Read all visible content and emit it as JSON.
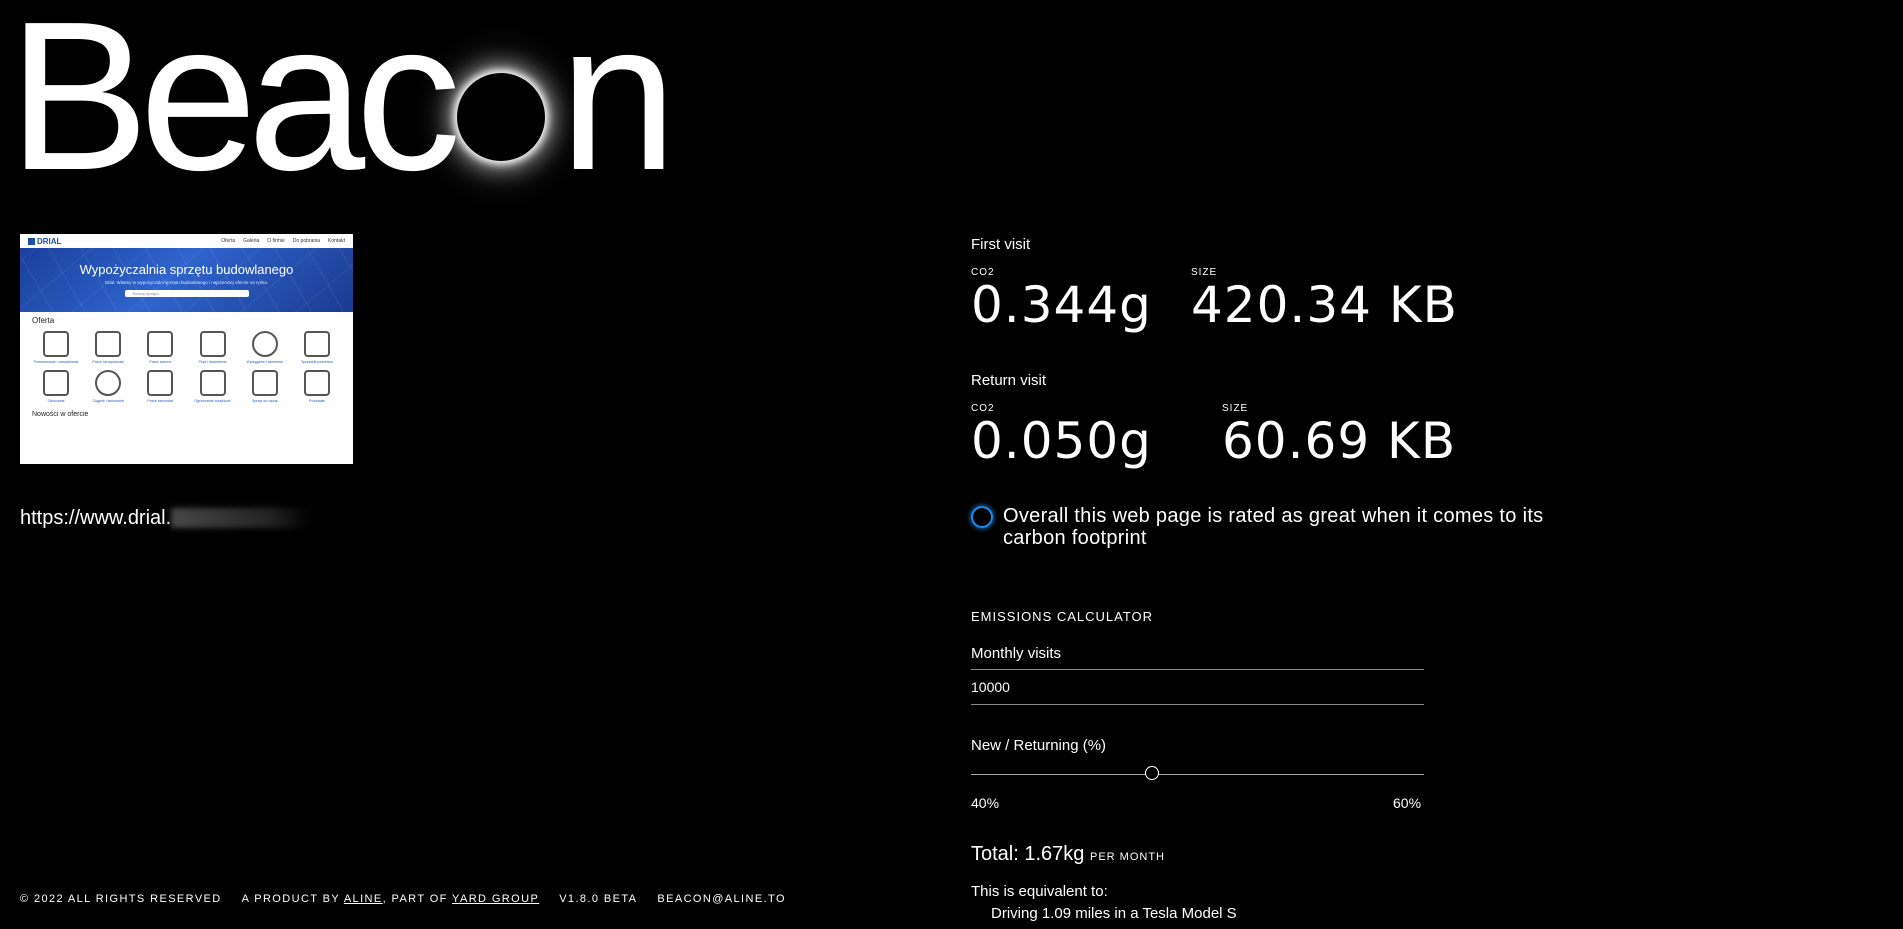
{
  "logo": {
    "before": "Beac",
    "after": "n"
  },
  "thumbnail": {
    "brand": "DRIAL",
    "nav": [
      "Oferta",
      "Galeria",
      "O firmie",
      "Do pobrania",
      "Kontakt"
    ],
    "hero_title": "Wypożyczalnia sprzętu budowlanego",
    "hero_subtitle": "Drial. Witamy w wypożyczalni sprzętu budowlanego i najszerszej ofercie na rynku.",
    "search_placeholder": "Szukaj sprzętu",
    "section": "Oferta",
    "items": [
      "Pomurowanie i odwadnianie",
      "Prace na wysokości",
      "Prace ziemne",
      "Prąd i oświetlenie",
      "Wyciąganie i wiercenie",
      "Sprężarki powietrza",
      "Osuszanie",
      "Ciągnie i ładowanie",
      "Prace betonowe",
      "Ogrzewanie budynków",
      "Sprzęt do cięcia",
      "Pozostałe"
    ],
    "footer_section": "Nowości w ofercie"
  },
  "url": "https://www.drial.",
  "first_visit": {
    "title": "First visit",
    "co2_label": "CO2",
    "co2": "0.344g",
    "size_label": "SIZE",
    "size": "420.34 KB"
  },
  "return_visit": {
    "title": "Return visit",
    "co2_label": "CO2",
    "co2": "0.050g",
    "size_label": "SIZE",
    "size": "60.69 KB"
  },
  "rating": "Overall this web page is rated as great when it comes to its carbon footprint",
  "calculator": {
    "title": "EMISSIONS CALCULATOR",
    "monthly_label": "Monthly visits",
    "monthly_value": "10000",
    "ratio_label": "New / Returning (%)",
    "new_pct_label": "40%",
    "returning_pct_label": "60%",
    "new_pct": 40,
    "total": "Total: 1.67kg",
    "per": "PER MONTH",
    "equiv_label": "This is equivalent to:",
    "equiv_item": "Driving 1.09 miles in a Tesla Model S"
  },
  "footer": {
    "copyright": "© 2022 ALL RIGHTS RESERVED",
    "product_prefix": "A PRODUCT BY",
    "aline": "ALINE",
    "part_of": ", PART OF",
    "yard": "YARD GROUP",
    "version": "V1.8.0 BETA",
    "email": "BEACON@ALINE.TO"
  },
  "colors": {
    "background": "#000000",
    "rating_accent": "#1d8cf0"
  }
}
